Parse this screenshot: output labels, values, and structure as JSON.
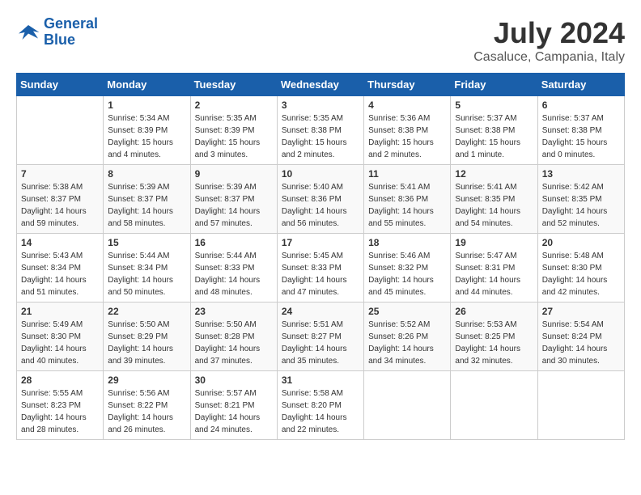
{
  "header": {
    "logo_line1": "General",
    "logo_line2": "Blue",
    "month_year": "July 2024",
    "location": "Casaluce, Campania, Italy"
  },
  "weekdays": [
    "Sunday",
    "Monday",
    "Tuesday",
    "Wednesday",
    "Thursday",
    "Friday",
    "Saturday"
  ],
  "weeks": [
    [
      {
        "day": null
      },
      {
        "day": "1",
        "sunrise": "Sunrise: 5:34 AM",
        "sunset": "Sunset: 8:39 PM",
        "daylight": "Daylight: 15 hours and 4 minutes."
      },
      {
        "day": "2",
        "sunrise": "Sunrise: 5:35 AM",
        "sunset": "Sunset: 8:39 PM",
        "daylight": "Daylight: 15 hours and 3 minutes."
      },
      {
        "day": "3",
        "sunrise": "Sunrise: 5:35 AM",
        "sunset": "Sunset: 8:38 PM",
        "daylight": "Daylight: 15 hours and 2 minutes."
      },
      {
        "day": "4",
        "sunrise": "Sunrise: 5:36 AM",
        "sunset": "Sunset: 8:38 PM",
        "daylight": "Daylight: 15 hours and 2 minutes."
      },
      {
        "day": "5",
        "sunrise": "Sunrise: 5:37 AM",
        "sunset": "Sunset: 8:38 PM",
        "daylight": "Daylight: 15 hours and 1 minute."
      },
      {
        "day": "6",
        "sunrise": "Sunrise: 5:37 AM",
        "sunset": "Sunset: 8:38 PM",
        "daylight": "Daylight: 15 hours and 0 minutes."
      }
    ],
    [
      {
        "day": "7",
        "sunrise": "Sunrise: 5:38 AM",
        "sunset": "Sunset: 8:37 PM",
        "daylight": "Daylight: 14 hours and 59 minutes."
      },
      {
        "day": "8",
        "sunrise": "Sunrise: 5:39 AM",
        "sunset": "Sunset: 8:37 PM",
        "daylight": "Daylight: 14 hours and 58 minutes."
      },
      {
        "day": "9",
        "sunrise": "Sunrise: 5:39 AM",
        "sunset": "Sunset: 8:37 PM",
        "daylight": "Daylight: 14 hours and 57 minutes."
      },
      {
        "day": "10",
        "sunrise": "Sunrise: 5:40 AM",
        "sunset": "Sunset: 8:36 PM",
        "daylight": "Daylight: 14 hours and 56 minutes."
      },
      {
        "day": "11",
        "sunrise": "Sunrise: 5:41 AM",
        "sunset": "Sunset: 8:36 PM",
        "daylight": "Daylight: 14 hours and 55 minutes."
      },
      {
        "day": "12",
        "sunrise": "Sunrise: 5:41 AM",
        "sunset": "Sunset: 8:35 PM",
        "daylight": "Daylight: 14 hours and 54 minutes."
      },
      {
        "day": "13",
        "sunrise": "Sunrise: 5:42 AM",
        "sunset": "Sunset: 8:35 PM",
        "daylight": "Daylight: 14 hours and 52 minutes."
      }
    ],
    [
      {
        "day": "14",
        "sunrise": "Sunrise: 5:43 AM",
        "sunset": "Sunset: 8:34 PM",
        "daylight": "Daylight: 14 hours and 51 minutes."
      },
      {
        "day": "15",
        "sunrise": "Sunrise: 5:44 AM",
        "sunset": "Sunset: 8:34 PM",
        "daylight": "Daylight: 14 hours and 50 minutes."
      },
      {
        "day": "16",
        "sunrise": "Sunrise: 5:44 AM",
        "sunset": "Sunset: 8:33 PM",
        "daylight": "Daylight: 14 hours and 48 minutes."
      },
      {
        "day": "17",
        "sunrise": "Sunrise: 5:45 AM",
        "sunset": "Sunset: 8:33 PM",
        "daylight": "Daylight: 14 hours and 47 minutes."
      },
      {
        "day": "18",
        "sunrise": "Sunrise: 5:46 AM",
        "sunset": "Sunset: 8:32 PM",
        "daylight": "Daylight: 14 hours and 45 minutes."
      },
      {
        "day": "19",
        "sunrise": "Sunrise: 5:47 AM",
        "sunset": "Sunset: 8:31 PM",
        "daylight": "Daylight: 14 hours and 44 minutes."
      },
      {
        "day": "20",
        "sunrise": "Sunrise: 5:48 AM",
        "sunset": "Sunset: 8:30 PM",
        "daylight": "Daylight: 14 hours and 42 minutes."
      }
    ],
    [
      {
        "day": "21",
        "sunrise": "Sunrise: 5:49 AM",
        "sunset": "Sunset: 8:30 PM",
        "daylight": "Daylight: 14 hours and 40 minutes."
      },
      {
        "day": "22",
        "sunrise": "Sunrise: 5:50 AM",
        "sunset": "Sunset: 8:29 PM",
        "daylight": "Daylight: 14 hours and 39 minutes."
      },
      {
        "day": "23",
        "sunrise": "Sunrise: 5:50 AM",
        "sunset": "Sunset: 8:28 PM",
        "daylight": "Daylight: 14 hours and 37 minutes."
      },
      {
        "day": "24",
        "sunrise": "Sunrise: 5:51 AM",
        "sunset": "Sunset: 8:27 PM",
        "daylight": "Daylight: 14 hours and 35 minutes."
      },
      {
        "day": "25",
        "sunrise": "Sunrise: 5:52 AM",
        "sunset": "Sunset: 8:26 PM",
        "daylight": "Daylight: 14 hours and 34 minutes."
      },
      {
        "day": "26",
        "sunrise": "Sunrise: 5:53 AM",
        "sunset": "Sunset: 8:25 PM",
        "daylight": "Daylight: 14 hours and 32 minutes."
      },
      {
        "day": "27",
        "sunrise": "Sunrise: 5:54 AM",
        "sunset": "Sunset: 8:24 PM",
        "daylight": "Daylight: 14 hours and 30 minutes."
      }
    ],
    [
      {
        "day": "28",
        "sunrise": "Sunrise: 5:55 AM",
        "sunset": "Sunset: 8:23 PM",
        "daylight": "Daylight: 14 hours and 28 minutes."
      },
      {
        "day": "29",
        "sunrise": "Sunrise: 5:56 AM",
        "sunset": "Sunset: 8:22 PM",
        "daylight": "Daylight: 14 hours and 26 minutes."
      },
      {
        "day": "30",
        "sunrise": "Sunrise: 5:57 AM",
        "sunset": "Sunset: 8:21 PM",
        "daylight": "Daylight: 14 hours and 24 minutes."
      },
      {
        "day": "31",
        "sunrise": "Sunrise: 5:58 AM",
        "sunset": "Sunset: 8:20 PM",
        "daylight": "Daylight: 14 hours and 22 minutes."
      },
      {
        "day": null
      },
      {
        "day": null
      },
      {
        "day": null
      }
    ]
  ]
}
